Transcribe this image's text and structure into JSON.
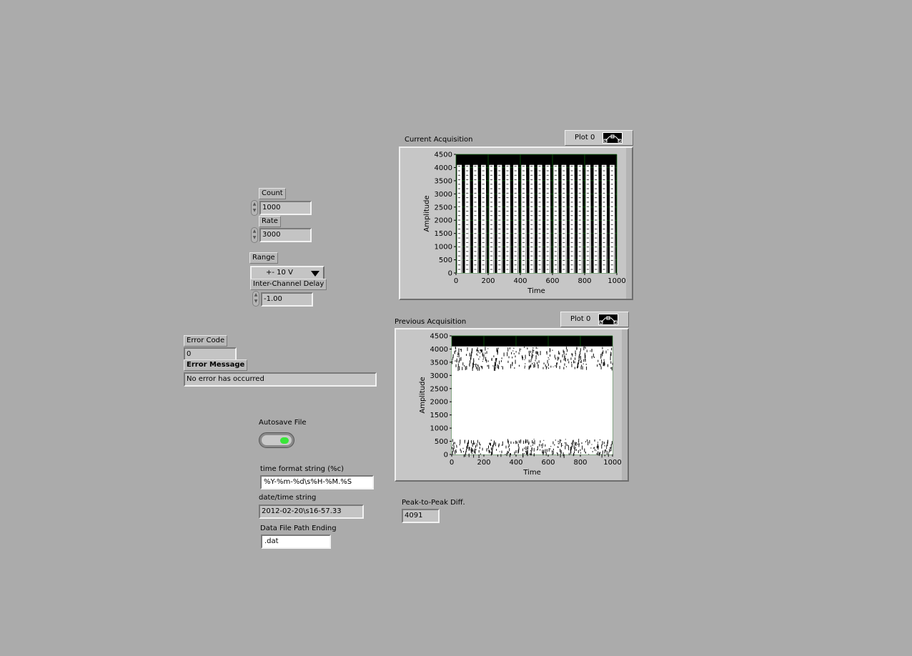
{
  "controls": {
    "count": {
      "label": "Count",
      "value": "1000"
    },
    "rate": {
      "label": "Rate",
      "value": "3000"
    },
    "range": {
      "label": "Range",
      "value": "+- 10 V"
    },
    "inter_channel_delay": {
      "label": "Inter-Channel Delay",
      "value": "-1.00"
    },
    "error_code": {
      "label": "Error Code",
      "value": "0"
    },
    "error_message": {
      "label": "Error Message",
      "value": "No error has occurred"
    },
    "autosave": {
      "label": "Autosave File",
      "state": "on",
      "led_color": "#39e639"
    },
    "time_format": {
      "label": "time format string (%c)",
      "value": "%Y-%m-%d\\s%H-%M.%S"
    },
    "datetime_string": {
      "label": "date/time string",
      "value": "2012-02-20\\s16-57.33"
    },
    "file_path_ending": {
      "label": "Data File Path Ending",
      "value": ".dat"
    },
    "peak_to_peak": {
      "label": "Peak-to-Peak Diff.",
      "value": "4091"
    }
  },
  "colors": {
    "panel_bg": "#ababab",
    "plot_bg": "#000000",
    "trace": "#ffffff",
    "grid": "#0c6b0c"
  },
  "chart_data": [
    {
      "type": "line",
      "title": "Current Acquisition",
      "legend_label": "Plot 0",
      "xlabel": "Time",
      "ylabel": "Amplitude",
      "xlim": [
        0,
        1000
      ],
      "ylim": [
        0,
        4500
      ],
      "xticks": [
        0,
        200,
        400,
        600,
        800,
        1000
      ],
      "yticks": [
        0,
        500,
        1000,
        1500,
        2000,
        2500,
        3000,
        3500,
        4000,
        4500
      ],
      "series": [
        {
          "pattern": "square_wave",
          "periods": 20,
          "low": 0,
          "high": 4100
        }
      ],
      "grid": true
    },
    {
      "type": "scatter",
      "title": "Previous Acquisition",
      "legend_label": "Plot 0",
      "xlabel": "Time",
      "ylabel": "Amplitude",
      "xlim": [
        0,
        1000
      ],
      "ylim": [
        0,
        4500
      ],
      "xticks": [
        0,
        200,
        400,
        600,
        800,
        1000
      ],
      "yticks": [
        0,
        500,
        1000,
        1500,
        2000,
        2500,
        3000,
        3500,
        4000,
        4500
      ],
      "series": [
        {
          "pattern": "noise_bands",
          "bands": [
            {
              "low": 0,
              "high": 600
            },
            {
              "low": 3300,
              "high": 4100
            }
          ]
        }
      ],
      "grid": true
    }
  ]
}
